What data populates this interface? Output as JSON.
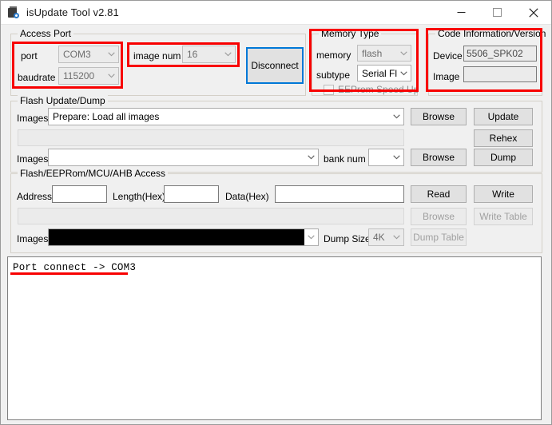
{
  "window": {
    "title": "isUpdate Tool v2.81",
    "icon": "app-icon",
    "minimize_label": "─",
    "maximize_label": "□",
    "close_label": "✕"
  },
  "access_port": {
    "legend": "Access Port",
    "port_label": "port",
    "port_value": "COM3",
    "baudrate_label": "baudrate",
    "baudrate_value": "115200",
    "image_num_label": "image num",
    "image_num_value": "16",
    "disconnect_label": "Disconnect"
  },
  "memory_type": {
    "legend": "Memory Type",
    "memory_label": "memory",
    "memory_value": "flash",
    "subtype_label": "subtype",
    "subtype_value": "Serial Flas",
    "eeprom_speedup_label": "EEProm Speed Up"
  },
  "code_info": {
    "legend": "Code Information/Version",
    "device_label": "Device",
    "device_value": "5506_SPK02",
    "image_label": "Image",
    "image_value": ""
  },
  "flash_update": {
    "legend": "Flash Update/Dump",
    "images_label_1": "Images",
    "images_value_1": "Prepare: Load all images",
    "path_value": "",
    "images_label_2": "Images",
    "images_value_2": "",
    "bank_num_label": "bank num",
    "bank_num_value": "",
    "browse_1": "Browse",
    "update": "Update",
    "rehex": "Rehex",
    "browse_2": "Browse",
    "dump": "Dump"
  },
  "access": {
    "legend": "Flash/EEPRom/MCU/AHB Access",
    "address_label": "Address",
    "address_value": "",
    "length_label": "Length(Hex)",
    "length_value": "",
    "data_label": "Data(Hex)",
    "data_value": "",
    "path_value": "",
    "images_label": "Images",
    "images_value": "",
    "dump_size_label": "Dump Size",
    "dump_size_value": "4K",
    "read": "Read",
    "write": "Write",
    "browse": "Browse",
    "write_table": "Write Table",
    "dump_table": "Dump Table"
  },
  "log": {
    "line_1": "Port connect -> COM3"
  },
  "colors": {
    "annotation": "#f80000",
    "focus": "#0078d7",
    "window_bg": "#f0f0f0"
  }
}
